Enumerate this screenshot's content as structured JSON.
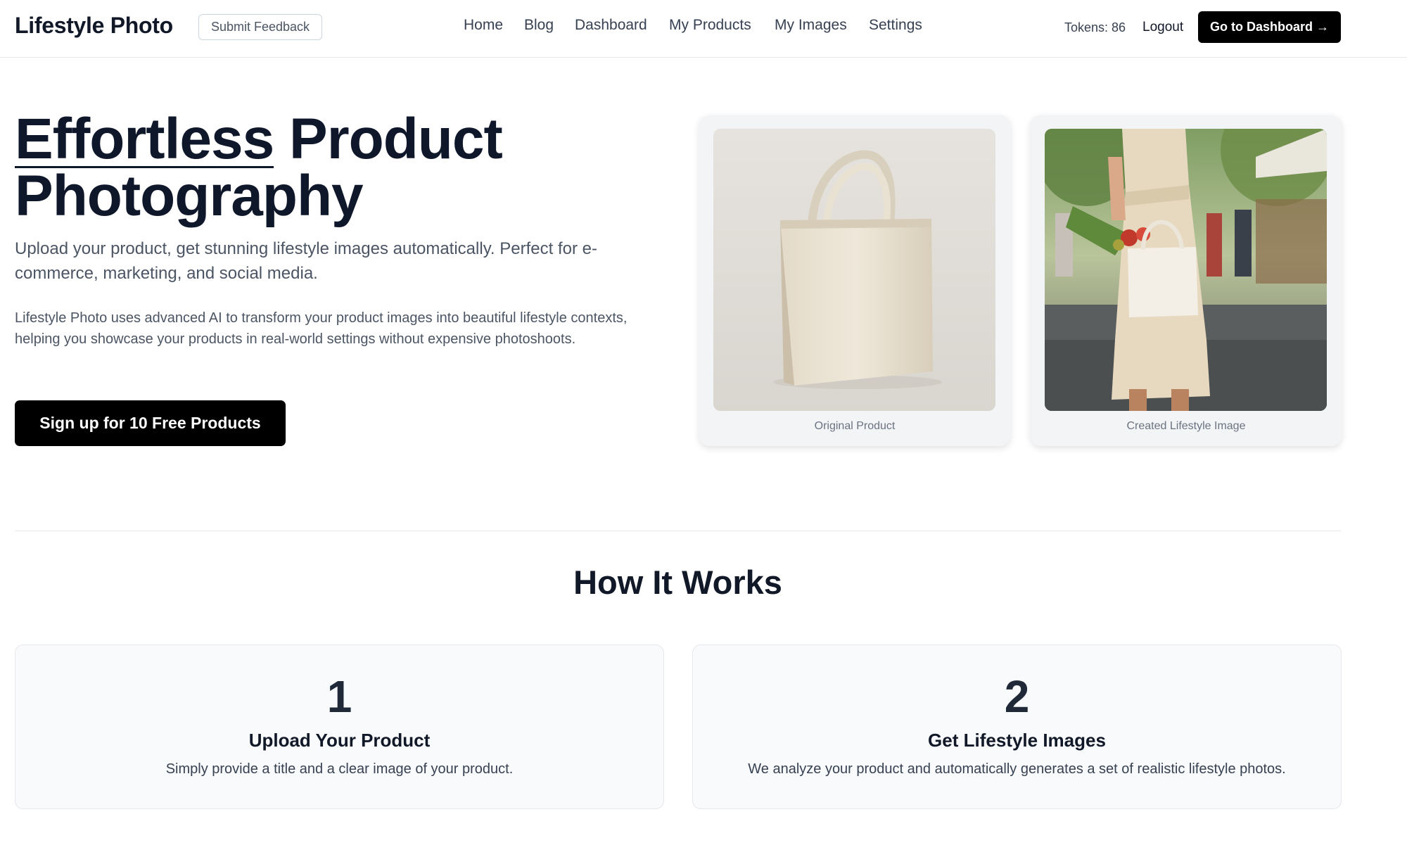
{
  "header": {
    "brand": "Lifestyle Photo",
    "feedback_label": "Submit Feedback",
    "nav": [
      "Home",
      "Blog",
      "Dashboard",
      "My Products",
      "My Images",
      "Settings"
    ],
    "tokens": "Tokens: 86",
    "logout_label": "Logout",
    "dashboard_label": "Go to Dashboard →"
  },
  "hero": {
    "title_word_1": "Effortless",
    "title_rest": " Product Photography",
    "subtitle": "Upload your product, get stunning lifestyle images automatically. Perfect for e-commerce, marketing, and social media.",
    "description": "Lifestyle Photo uses advanced AI to transform your product images into beautiful lifestyle contexts, helping you showcase your products in real-world settings without expensive photoshoots.",
    "cta_label": "Sign up for 10 Free Products",
    "images": [
      {
        "caption": "Original Product"
      },
      {
        "caption": "Created Lifestyle Image"
      }
    ]
  },
  "how": {
    "title": "How It Works",
    "steps": [
      {
        "number": "1",
        "title": "Upload Your Product",
        "desc": "Simply provide a title and a clear image of your product."
      },
      {
        "number": "2",
        "title": "Get Lifestyle Images",
        "desc": "We analyze your product and automatically generates a set of realistic lifestyle photos."
      }
    ]
  },
  "colors": {
    "primary_button": "#000000",
    "text_dark": "#0f172a",
    "text_muted": "#4b5563",
    "card_bg": "#f3f4f6"
  }
}
